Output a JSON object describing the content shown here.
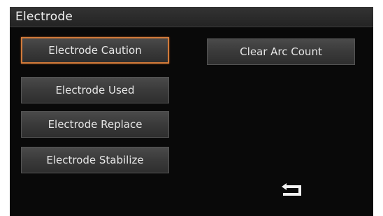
{
  "window": {
    "title": "Electrode"
  },
  "menu": {
    "electrode_caution": "Electrode Caution",
    "electrode_used": "Electrode Used",
    "electrode_replace": "Electrode Replace",
    "electrode_stabilize": "Electrode Stabilize",
    "clear_arc_count": "Clear Arc Count"
  },
  "icons": {
    "back": "return-arrow-icon"
  },
  "colors": {
    "background": "#090909",
    "button": "#3a3a3a",
    "selected_border": "#d27a3a",
    "text": "#e6e6e6"
  }
}
